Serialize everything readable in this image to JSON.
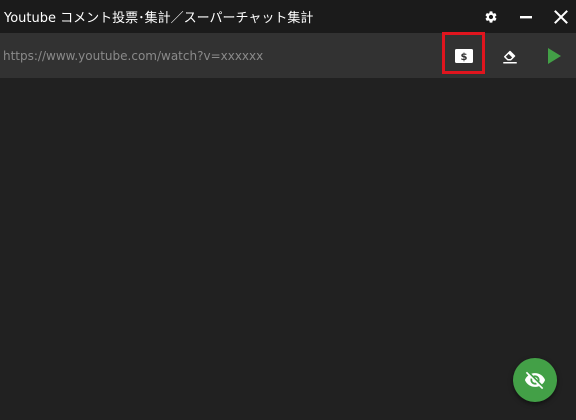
{
  "window": {
    "title": "Youtube コメント投票･集計／スーパーチャット集計"
  },
  "titlebar_buttons": {
    "settings_icon": "gear-icon",
    "minimize_icon": "minimize-icon",
    "close_icon": "close-icon"
  },
  "toolbar": {
    "url_placeholder": "https://www.youtube.com/watch?v=xxxxxx",
    "url_value": "",
    "superchat_icon": "money-icon",
    "clear_icon": "eraser-icon",
    "start_icon": "play-icon"
  },
  "fab": {
    "icon": "eye-off-icon"
  },
  "colors": {
    "titlebar": "#1b1b1b",
    "toolbar": "#323232",
    "background": "#212121",
    "play_green": "#43a047",
    "fab_green": "#43a047",
    "highlight_red": "#e0151e"
  }
}
